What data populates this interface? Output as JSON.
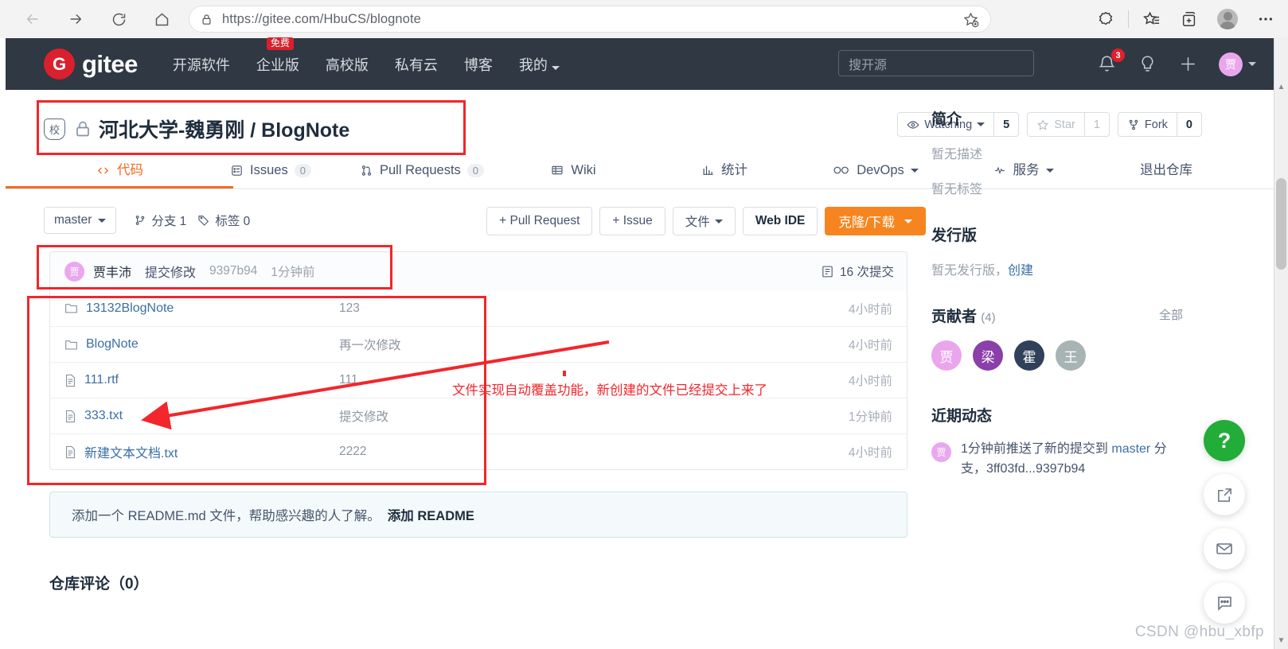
{
  "browser": {
    "url": "https://gitee.com/HbuCS/blognote",
    "back_icon": "back-arrow-icon",
    "forward_icon": "forward-arrow-icon",
    "reload_icon": "reload-icon",
    "home_icon": "home-icon",
    "lock_icon": "lock-icon",
    "favorite_icon": "add-favorite-icon",
    "collections_icon": "collections-icon",
    "favorites_icon": "favorites-icon",
    "tabs_icon": "add-tab-icon",
    "profile_icon": "profile-avatar-icon",
    "more_icon": "more-options-icon"
  },
  "gitee_header": {
    "logo_letter": "G",
    "logo_text": "gitee",
    "nav": [
      {
        "label": "开源软件",
        "badge": ""
      },
      {
        "label": "企业版",
        "badge": "免费"
      },
      {
        "label": "高校版",
        "badge": ""
      },
      {
        "label": "私有云",
        "badge": ""
      },
      {
        "label": "博客",
        "badge": ""
      },
      {
        "label": "我的",
        "badge": "",
        "caret": true
      }
    ],
    "search_placeholder": "搜开源",
    "notification_count": "3",
    "bell_icon": "bell-icon",
    "idea_icon": "lightbulb-icon",
    "plus_icon": "plus-icon",
    "user_initial": "贾"
  },
  "repo": {
    "school_badge": "校",
    "lock_icon": "private-lock-icon",
    "owner": "河北大学-魏勇刚",
    "separator": " / ",
    "name": "BlogNote",
    "watch": {
      "label": "Watching",
      "count": "5",
      "icon": "eye-icon"
    },
    "star": {
      "label": "Star",
      "count": "1",
      "icon": "star-icon"
    },
    "fork": {
      "label": "Fork",
      "count": "0",
      "icon": "fork-icon"
    },
    "tabs": [
      {
        "label": "代码",
        "icon": "code-icon",
        "count": "",
        "active": true
      },
      {
        "label": "Issues",
        "icon": "issues-icon",
        "count": "0",
        "active": false
      },
      {
        "label": "Pull Requests",
        "icon": "pull-request-icon",
        "count": "0",
        "active": false
      },
      {
        "label": "Wiki",
        "icon": "wiki-icon",
        "count": "",
        "active": false
      },
      {
        "label": "统计",
        "icon": "stats-icon",
        "count": "",
        "active": false
      },
      {
        "label": "DevOps",
        "icon": "devops-icon",
        "count": "",
        "active": false,
        "caret": true
      },
      {
        "label": "服务",
        "icon": "service-icon",
        "count": "",
        "active": false,
        "caret": true
      },
      {
        "label": "退出仓库",
        "icon": "",
        "count": "",
        "active": false
      }
    ]
  },
  "toolbar": {
    "branch": "master",
    "branches_label": "分支 1",
    "tags_label": "标签 0",
    "branch_icon": "branch-icon",
    "tag_icon": "tag-icon",
    "pull_request_btn": "+ Pull Request",
    "issue_btn": "+ Issue",
    "files_btn": "文件",
    "web_ide_btn": "Web IDE",
    "clone_btn": "克隆/下载"
  },
  "commit": {
    "author_initial": "贾",
    "author": "贾丰沛",
    "message": "提交修改",
    "sha": "9397b94",
    "time": "1分钟前",
    "count_label": "16 次提交",
    "count_icon": "commit-history-icon"
  },
  "files": {
    "rows": [
      {
        "icon": "folder-icon",
        "name": "13132BlogNote",
        "message": "123",
        "time": "4小时前"
      },
      {
        "icon": "folder-icon",
        "name": "BlogNote",
        "message": "再一次修改",
        "time": "4小时前"
      },
      {
        "icon": "file-icon",
        "name": "111.rtf",
        "message": "111",
        "time": "4小时前"
      },
      {
        "icon": "file-icon",
        "name": "333.txt",
        "message": "提交修改",
        "time": "1分钟前"
      },
      {
        "icon": "file-icon",
        "name": "新建文本文档.txt",
        "message": "2222",
        "time": "4小时前"
      }
    ]
  },
  "readme_banner": {
    "text": "添加一个 README.md 文件，帮助感兴趣的人了解。",
    "action": "添加 README"
  },
  "comments_heading": "仓库评论（0）",
  "sidebar": {
    "intro_heading": "简介",
    "no_description": "暂无描述",
    "no_tags": "暂无标签",
    "release_heading": "发行版",
    "no_release": "暂无发行版，",
    "create_link": "创建",
    "contributors_heading": "贡献者",
    "contributors_count": "(4)",
    "contributors_all": "全部",
    "contributors": [
      {
        "initial": "贾",
        "color": "#eaa6ec"
      },
      {
        "initial": "梁",
        "color": "#8b3fa8"
      },
      {
        "initial": "霍",
        "color": "#32415a"
      },
      {
        "initial": "王",
        "color": "#a8b3b3"
      }
    ],
    "activity_heading": "近期动态",
    "activity": {
      "avatar_initial": "贾",
      "text_prefix": "1分钟前推送了新的提交到 ",
      "branch": "master",
      "text_suffix": " 分支，3ff03fd...9397b94"
    }
  },
  "fabs": [
    {
      "icon": "help-icon",
      "label": "?"
    },
    {
      "icon": "share-icon",
      "label": ""
    },
    {
      "icon": "mail-icon",
      "label": ""
    },
    {
      "icon": "feedback-icon",
      "label": ""
    }
  ],
  "annotation": {
    "note": "文件实现自动覆盖功能，新创建的文件已经提交上来了",
    "color": "#f2262b"
  },
  "watermark": "CSDN @hbu_xbfp"
}
